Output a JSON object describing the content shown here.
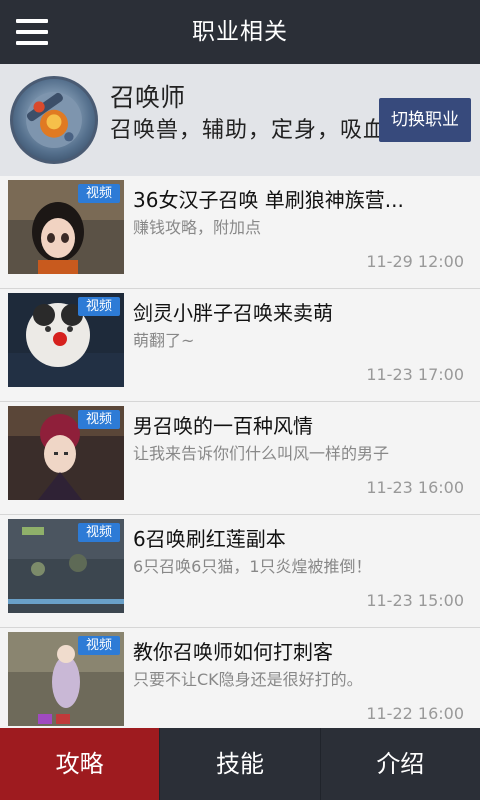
{
  "header": {
    "title": "职业相关",
    "menu_icon": "menu-icon"
  },
  "profile": {
    "name": "召唤师",
    "description": "召唤兽，辅助，定身，吸血",
    "switch_label": "切换职业"
  },
  "articles": [
    {
      "badge": "视频",
      "title": "36女汉子召唤 单刷狼神族营...",
      "subtitle": "赚钱攻略，附加点",
      "time": "11-29 12:00"
    },
    {
      "badge": "视频",
      "title": "剑灵小胖子召唤来卖萌",
      "subtitle": "萌翻了~",
      "time": "11-23 17:00"
    },
    {
      "badge": "视频",
      "title": "男召唤的一百种风情",
      "subtitle": "让我来告诉你们什么叫风一样的男子",
      "time": "11-23 16:00"
    },
    {
      "badge": "视频",
      "title": "6召唤刷红莲副本",
      "subtitle": "6只召唤6只猫，1只炎煌被推倒！",
      "time": "11-23 15:00"
    },
    {
      "badge": "视频",
      "title": "教你召唤师如何打刺客",
      "subtitle": "只要不让CK隐身还是很好打的。",
      "time": "11-22 16:00"
    }
  ],
  "tabs": [
    {
      "label": "攻略",
      "active": true
    },
    {
      "label": "技能",
      "active": false
    },
    {
      "label": "介绍",
      "active": false
    }
  ],
  "colors": {
    "topbar": "#2b2f37",
    "active_tab": "#9e1b1f",
    "switch_button": "#374a7c",
    "badge": "#2d7bd6"
  }
}
